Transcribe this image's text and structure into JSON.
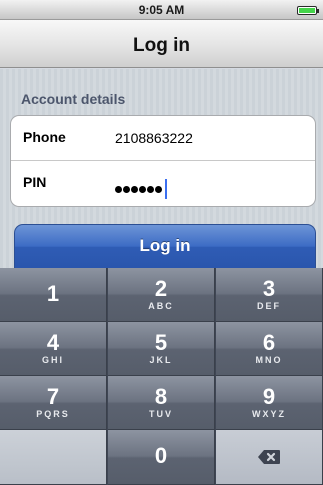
{
  "status_bar": {
    "time": "9:05 AM",
    "battery_color": "#44d44a"
  },
  "nav_bar": {
    "title": "Log in"
  },
  "form": {
    "section_header": "Account details",
    "phone": {
      "label": "Phone",
      "value": "2108863222"
    },
    "pin": {
      "label": "PIN",
      "masked_length": 6
    }
  },
  "login_button": {
    "label": "Log in",
    "accent": "#3c6bc4"
  },
  "keypad": {
    "keys": [
      {
        "digit": "1",
        "letters": ""
      },
      {
        "digit": "2",
        "letters": "ABC"
      },
      {
        "digit": "3",
        "letters": "DEF"
      },
      {
        "digit": "4",
        "letters": "GHI"
      },
      {
        "digit": "5",
        "letters": "JKL"
      },
      {
        "digit": "6",
        "letters": "MNO"
      },
      {
        "digit": "7",
        "letters": "PQRS"
      },
      {
        "digit": "8",
        "letters": "TUV"
      },
      {
        "digit": "9",
        "letters": "WXYZ"
      },
      {
        "digit": "0",
        "letters": ""
      }
    ],
    "backspace_icon": "backspace-icon"
  }
}
